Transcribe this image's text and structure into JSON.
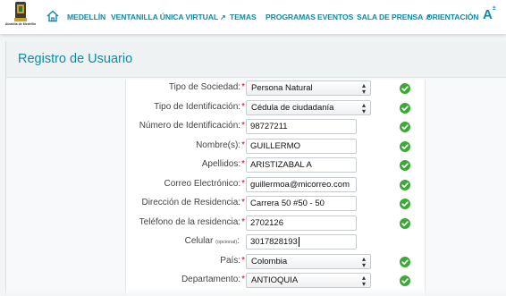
{
  "header": {
    "logo_caption": "Alcaldía de Medellín",
    "nav": [
      {
        "label": "MEDELLÍN",
        "external": false
      },
      {
        "label": "VENTANILLA ÚNICA VIRTUAL",
        "external": true
      },
      {
        "label": "TEMAS",
        "external": false
      },
      {
        "label": "PROGRAMAS",
        "external": false
      },
      {
        "label": "EVENTOS",
        "external": false
      },
      {
        "label": "SALA DE PRENSA",
        "external": true
      },
      {
        "label": "ORIENTACIÓN",
        "external": false
      }
    ],
    "font_size_control": "A",
    "font_size_control_sup": "±"
  },
  "panel": {
    "title": "Registro de Usuario"
  },
  "form": {
    "required_mark": "*",
    "fields": [
      {
        "label": "Tipo de Sociedad:",
        "required": true,
        "type": "select",
        "value": "Persona Natural",
        "valid": true
      },
      {
        "label": "Tipo de Identificación:",
        "required": true,
        "type": "select",
        "value": "Cédula de ciudadanía",
        "valid": true
      },
      {
        "label": "Número de Identificación:",
        "required": true,
        "type": "text",
        "value": "98727211",
        "valid": true
      },
      {
        "label": "Nombre(s):",
        "required": true,
        "type": "text",
        "value": "GUILLERMO",
        "valid": true
      },
      {
        "label": "Apellidos:",
        "required": true,
        "type": "text",
        "value": "ARISTIZABAL A",
        "valid": true
      },
      {
        "label": "Correo Electrónico:",
        "required": true,
        "type": "text",
        "value": "guillermoa@micorreo.com",
        "valid": true
      },
      {
        "label": "Dirección de Residencia:",
        "required": true,
        "type": "text",
        "value": "Carrera 50 #50 - 50",
        "valid": true
      },
      {
        "label": "Teléfono de la residencia:",
        "required": true,
        "type": "text",
        "value": "2702126",
        "valid": true
      },
      {
        "label": "Celular",
        "optional_note": "(opcional)",
        "label_suffix": ":",
        "required": false,
        "type": "text",
        "value": "3017828193",
        "valid": false,
        "focused": true
      },
      {
        "label": "País:",
        "required": true,
        "type": "select",
        "value": "Colombia",
        "valid": true
      },
      {
        "label": "Departamento:",
        "required": true,
        "type": "select",
        "value": "ANTIOQUIA",
        "valid": true
      }
    ]
  },
  "colors": {
    "brand": "#0f8aa8",
    "required": "#d0021b",
    "valid": "#3aa935"
  }
}
